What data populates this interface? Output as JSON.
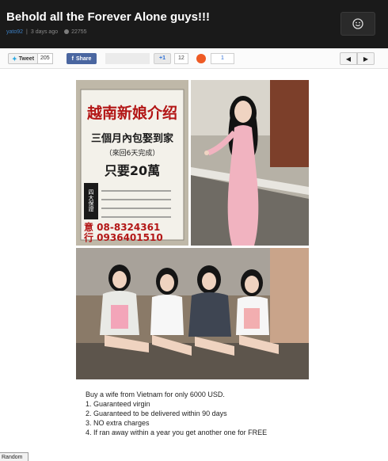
{
  "header": {
    "title": "Behold all the Forever Alone guys!!!",
    "user": "yato92",
    "separator": "|",
    "time_ago": "3 days ago",
    "views": "22755"
  },
  "sharebar": {
    "tweet_label": "Tweet",
    "tweet_count": "205",
    "fb_label": "Share",
    "plusone_label": "+1",
    "plusone_count": "12",
    "stumble_count": "1"
  },
  "image": {
    "sign_text": [
      "越南新娘介绍",
      "三個月內包娶到家",
      "（來回6天完成）",
      "只要20萬",
      "四大保證",
      "意 08-8324361",
      "行 0936401510"
    ]
  },
  "caption": {
    "lines": [
      "Buy a wife from Vietnam for only 6000 USD.",
      "1. Guaranteed virgin",
      "2. Guaranteed to be delivered within 90 days",
      "3. NO extra charges",
      "4. If ran away within a year you get another one for FREE"
    ]
  },
  "footer": {
    "random_label": "Random"
  },
  "colors": {
    "header_bg": "#1a1a1a",
    "link": "#3b7fc4",
    "facebook": "#4a66a0",
    "stumble": "#ee5a24"
  }
}
